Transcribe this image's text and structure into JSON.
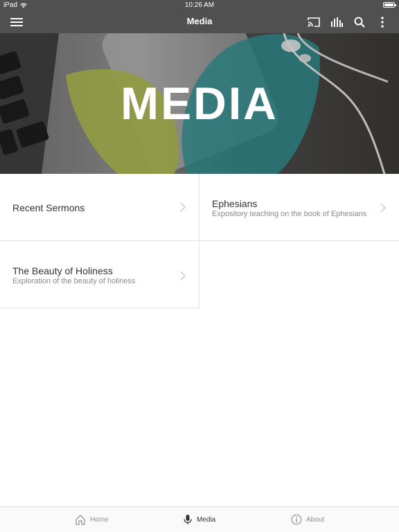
{
  "status_bar": {
    "device": "iPad",
    "time": "10:26 AM"
  },
  "nav": {
    "title": "Media",
    "icons": [
      "hamburger-menu-icon",
      "cast-icon",
      "audio-bars-icon",
      "search-icon",
      "more-vertical-icon"
    ]
  },
  "hero": {
    "title": "MEDIA"
  },
  "media_items": [
    {
      "title": "Recent Sermons",
      "subtitle": ""
    },
    {
      "title": "Ephesians",
      "subtitle": "Expository teaching on the book of Ephesians"
    },
    {
      "title": "The Beauty of Holiness",
      "subtitle": "Exploration of the beauty of holiness"
    }
  ],
  "tabs": [
    {
      "label": "Home",
      "icon": "home-icon",
      "active": false
    },
    {
      "label": "Media",
      "icon": "microphone-icon",
      "active": true
    },
    {
      "label": "About",
      "icon": "info-icon",
      "active": false
    }
  ],
  "colors": {
    "bar": "#505050",
    "accent_teal": "#2f8a8c",
    "accent_green": "#a5b14a"
  }
}
